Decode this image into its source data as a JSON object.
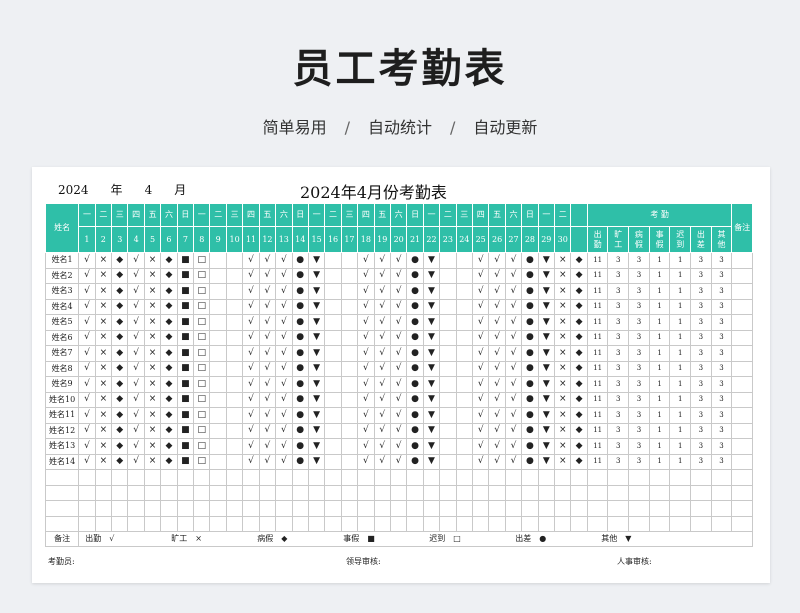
{
  "page": {
    "title": "员工考勤表",
    "subtitle": [
      "简单易用",
      "自动统计",
      "自动更新"
    ],
    "subtitle_sep": "/"
  },
  "sheet": {
    "year": "2024",
    "year_label": "年",
    "month": "4",
    "month_label": "月",
    "title": "2024年4月份考勤表",
    "name_header": "姓名",
    "weekdays": [
      "一",
      "二",
      "三",
      "四",
      "五",
      "六",
      "日",
      "一",
      "二",
      "三",
      "四",
      "五",
      "六",
      "日",
      "一",
      "二",
      "三",
      "四",
      "五",
      "六",
      "日",
      "一",
      "二",
      "三",
      "四",
      "五",
      "六",
      "日",
      "一",
      "二"
    ],
    "days": [
      "1",
      "2",
      "3",
      "4",
      "5",
      "6",
      "7",
      "8",
      "9",
      "10",
      "11",
      "12",
      "13",
      "14",
      "15",
      "16",
      "17",
      "18",
      "19",
      "20",
      "21",
      "22",
      "23",
      "24",
      "25",
      "26",
      "27",
      "28",
      "29",
      "30"
    ],
    "stats_header": "考    勤",
    "stats_cols": [
      "出勤",
      "旷工",
      "病假",
      "事假",
      "迟到",
      "出差",
      "其他"
    ],
    "remark_header": "备注",
    "rows": [
      {
        "name": "姓名1",
        "marks": [
          "√",
          "×",
          "◆",
          "√",
          "×",
          "◆",
          "■",
          "□",
          "",
          "",
          "√",
          "√",
          "√",
          "●",
          "▼",
          "",
          "",
          "√",
          "√",
          "√",
          "●",
          "▼",
          "",
          "",
          "√",
          "√",
          "√",
          "●",
          "▼",
          "×",
          "◆"
        ],
        "counts": [
          "11",
          "3",
          "3",
          "1",
          "1",
          "3",
          "3"
        ]
      },
      {
        "name": "姓名2",
        "marks": [
          "√",
          "×",
          "◆",
          "√",
          "×",
          "◆",
          "■",
          "□",
          "",
          "",
          "√",
          "√",
          "√",
          "●",
          "▼",
          "",
          "",
          "√",
          "√",
          "√",
          "●",
          "▼",
          "",
          "",
          "√",
          "√",
          "√",
          "●",
          "▼",
          "×",
          "◆"
        ],
        "counts": [
          "11",
          "3",
          "3",
          "1",
          "1",
          "3",
          "3"
        ]
      },
      {
        "name": "姓名3",
        "marks": [
          "√",
          "×",
          "◆",
          "√",
          "×",
          "◆",
          "■",
          "□",
          "",
          "",
          "√",
          "√",
          "√",
          "●",
          "▼",
          "",
          "",
          "√",
          "√",
          "√",
          "●",
          "▼",
          "",
          "",
          "√",
          "√",
          "√",
          "●",
          "▼",
          "×",
          "◆"
        ],
        "counts": [
          "11",
          "3",
          "3",
          "1",
          "1",
          "3",
          "3"
        ]
      },
      {
        "name": "姓名4",
        "marks": [
          "√",
          "×",
          "◆",
          "√",
          "×",
          "◆",
          "■",
          "□",
          "",
          "",
          "√",
          "√",
          "√",
          "●",
          "▼",
          "",
          "",
          "√",
          "√",
          "√",
          "●",
          "▼",
          "",
          "",
          "√",
          "√",
          "√",
          "●",
          "▼",
          "×",
          "◆"
        ],
        "counts": [
          "11",
          "3",
          "3",
          "1",
          "1",
          "3",
          "3"
        ]
      },
      {
        "name": "姓名5",
        "marks": [
          "√",
          "×",
          "◆",
          "√",
          "×",
          "◆",
          "■",
          "□",
          "",
          "",
          "√",
          "√",
          "√",
          "●",
          "▼",
          "",
          "",
          "√",
          "√",
          "√",
          "●",
          "▼",
          "",
          "",
          "√",
          "√",
          "√",
          "●",
          "▼",
          "×",
          "◆"
        ],
        "counts": [
          "11",
          "3",
          "3",
          "1",
          "1",
          "3",
          "3"
        ]
      },
      {
        "name": "姓名6",
        "marks": [
          "√",
          "×",
          "◆",
          "√",
          "×",
          "◆",
          "■",
          "□",
          "",
          "",
          "√",
          "√",
          "√",
          "●",
          "▼",
          "",
          "",
          "√",
          "√",
          "√",
          "●",
          "▼",
          "",
          "",
          "√",
          "√",
          "√",
          "●",
          "▼",
          "×",
          "◆"
        ],
        "counts": [
          "11",
          "3",
          "3",
          "1",
          "1",
          "3",
          "3"
        ]
      },
      {
        "name": "姓名7",
        "marks": [
          "√",
          "×",
          "◆",
          "√",
          "×",
          "◆",
          "■",
          "□",
          "",
          "",
          "√",
          "√",
          "√",
          "●",
          "▼",
          "",
          "",
          "√",
          "√",
          "√",
          "●",
          "▼",
          "",
          "",
          "√",
          "√",
          "√",
          "●",
          "▼",
          "×",
          "◆"
        ],
        "counts": [
          "11",
          "3",
          "3",
          "1",
          "1",
          "3",
          "3"
        ]
      },
      {
        "name": "姓名8",
        "marks": [
          "√",
          "×",
          "◆",
          "√",
          "×",
          "◆",
          "■",
          "□",
          "",
          "",
          "√",
          "√",
          "√",
          "●",
          "▼",
          "",
          "",
          "√",
          "√",
          "√",
          "●",
          "▼",
          "",
          "",
          "√",
          "√",
          "√",
          "●",
          "▼",
          "×",
          "◆"
        ],
        "counts": [
          "11",
          "3",
          "3",
          "1",
          "1",
          "3",
          "3"
        ]
      },
      {
        "name": "姓名9",
        "marks": [
          "√",
          "×",
          "◆",
          "√",
          "×",
          "◆",
          "■",
          "□",
          "",
          "",
          "√",
          "√",
          "√",
          "●",
          "▼",
          "",
          "",
          "√",
          "√",
          "√",
          "●",
          "▼",
          "",
          "",
          "√",
          "√",
          "√",
          "●",
          "▼",
          "×",
          "◆"
        ],
        "counts": [
          "11",
          "3",
          "3",
          "1",
          "1",
          "3",
          "3"
        ]
      },
      {
        "name": "姓名10",
        "marks": [
          "√",
          "×",
          "◆",
          "√",
          "×",
          "◆",
          "■",
          "□",
          "",
          "",
          "√",
          "√",
          "√",
          "●",
          "▼",
          "",
          "",
          "√",
          "√",
          "√",
          "●",
          "▼",
          "",
          "",
          "√",
          "√",
          "√",
          "●",
          "▼",
          "×",
          "◆"
        ],
        "counts": [
          "11",
          "3",
          "3",
          "1",
          "1",
          "3",
          "3"
        ]
      },
      {
        "name": "姓名11",
        "marks": [
          "√",
          "×",
          "◆",
          "√",
          "×",
          "◆",
          "■",
          "□",
          "",
          "",
          "√",
          "√",
          "√",
          "●",
          "▼",
          "",
          "",
          "√",
          "√",
          "√",
          "●",
          "▼",
          "",
          "",
          "√",
          "√",
          "√",
          "●",
          "▼",
          "×",
          "◆"
        ],
        "counts": [
          "11",
          "3",
          "3",
          "1",
          "1",
          "3",
          "3"
        ]
      },
      {
        "name": "姓名12",
        "marks": [
          "√",
          "×",
          "◆",
          "√",
          "×",
          "◆",
          "■",
          "□",
          "",
          "",
          "√",
          "√",
          "√",
          "●",
          "▼",
          "",
          "",
          "√",
          "√",
          "√",
          "●",
          "▼",
          "",
          "",
          "√",
          "√",
          "√",
          "●",
          "▼",
          "×",
          "◆"
        ],
        "counts": [
          "11",
          "3",
          "3",
          "1",
          "1",
          "3",
          "3"
        ]
      },
      {
        "name": "姓名13",
        "marks": [
          "√",
          "×",
          "◆",
          "√",
          "×",
          "◆",
          "■",
          "□",
          "",
          "",
          "√",
          "√",
          "√",
          "●",
          "▼",
          "",
          "",
          "√",
          "√",
          "√",
          "●",
          "▼",
          "",
          "",
          "√",
          "√",
          "√",
          "●",
          "▼",
          "×",
          "◆"
        ],
        "counts": [
          "11",
          "3",
          "3",
          "1",
          "1",
          "3",
          "3"
        ]
      },
      {
        "name": "姓名14",
        "marks": [
          "√",
          "×",
          "◆",
          "√",
          "×",
          "◆",
          "■",
          "□",
          "",
          "",
          "√",
          "√",
          "√",
          "●",
          "▼",
          "",
          "",
          "√",
          "√",
          "√",
          "●",
          "▼",
          "",
          "",
          "√",
          "√",
          "√",
          "●",
          "▼",
          "×",
          "◆"
        ],
        "counts": [
          "11",
          "3",
          "3",
          "1",
          "1",
          "3",
          "3"
        ]
      }
    ],
    "empty_rows": 4,
    "legend_label": "备注",
    "legend": [
      {
        "label": "出勤",
        "symbol": "√"
      },
      {
        "label": "旷工",
        "symbol": "×"
      },
      {
        "label": "病假",
        "symbol": "◆"
      },
      {
        "label": "事假",
        "symbol": "■"
      },
      {
        "label": "迟到",
        "symbol": "□"
      },
      {
        "label": "出差",
        "symbol": "●"
      },
      {
        "label": "其他",
        "symbol": "▼"
      }
    ],
    "footer": {
      "recorder": "考勤员:",
      "leader": "领导审核:",
      "hr": "人事审核:"
    }
  },
  "colors": {
    "header_bg": "#2fbfa8",
    "page_bg": "#eef0f3"
  }
}
